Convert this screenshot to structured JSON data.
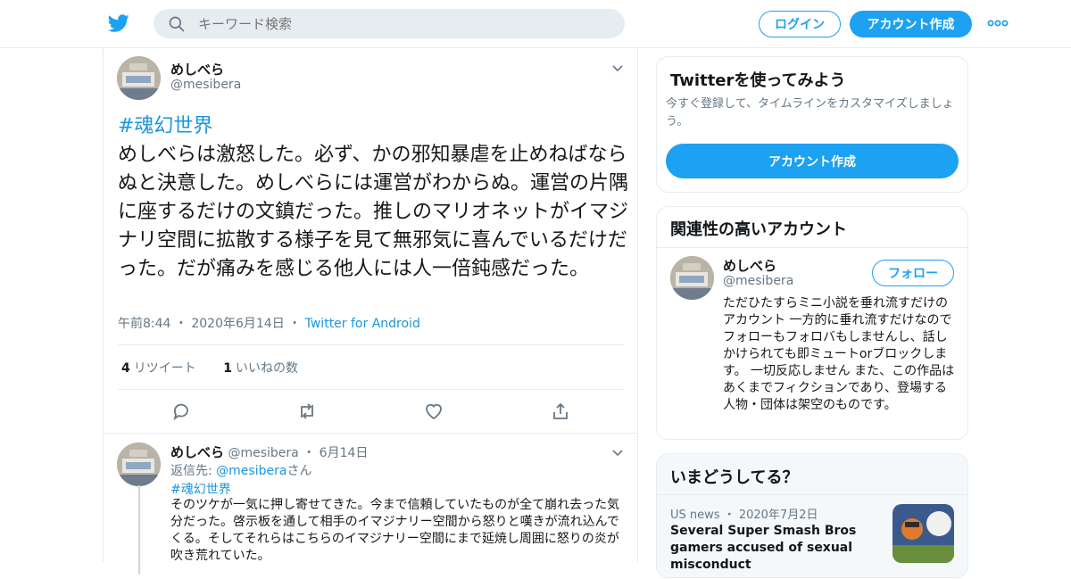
{
  "header": {
    "search_placeholder": "キーワード検索",
    "login_label": "ログイン",
    "signup_label": "アカウント作成"
  },
  "tweet": {
    "author_name": "めしべら",
    "author_handle": "@mesibera",
    "hashtag": "#魂幻世界",
    "body": "めしべらは激怒した。必ず、かの邪知暴虐を止めねばならぬと決意した。めしべらには運営がわからぬ。運営の片隅に座するだけの文鎮だった。推しのマリオネットがイマジナリ空間に拡散する様子を見て無邪気に喜んでいるだけだった。だが痛みを感じる他人には人一倍鈍感だった。",
    "time": "午前8:44",
    "date": "2020年6月14日",
    "source": "Twitter for Android",
    "retweet_count": "4",
    "retweet_label": "リツイート",
    "like_count": "1",
    "like_label": "いいねの数"
  },
  "reply": {
    "author_name": "めしべら",
    "author_handle": "@mesibera",
    "date": "6月14日",
    "reply_to_prefix": "返信先: ",
    "reply_to_handle": "@mesibera",
    "reply_to_suffix": "さん",
    "hashtag": "#魂幻世界",
    "body": "そのツケが一気に押し寄せてきた。今まで信頼していたものが全て崩れ去った気分だった。啓示板を通して相手のイマジナリー空間から怒りと嘆きが流れ込んでくる。そしてそれらはこちらのイマジナリー空間にまで延焼し周囲に怒りの炎が吹き荒れていた。"
  },
  "signup_card": {
    "title": "Twitterを使ってみよう",
    "description": "今すぐ登録して、タイムラインをカスタマイズしましょう。",
    "button_label": "アカウント作成"
  },
  "related_card": {
    "title": "関連性の高いアカウント",
    "name": "めしべら",
    "handle": "@mesibera",
    "follow_label": "フォロー",
    "bio": "ただひたすらミニ小説を垂れ流すだけのアカウント 一方的に垂れ流すだけなのでフォローもフォロバもしませんし、話しかけられても即ミュートorブロックします。 一切反応しません また、この作品はあくまでフィクションであり、登場する人物・団体は架空のものです。"
  },
  "trends_card": {
    "title": "いまどうしてる？",
    "category": "US news",
    "date": "2020年7月2日",
    "headline": "Several Super Smash Bros gamers accused of sexual misconduct"
  },
  "icons": [
    "twitter-bird-icon",
    "search-icon",
    "more-icon",
    "chevron-down-icon",
    "reply-icon",
    "retweet-icon",
    "like-icon",
    "share-icon"
  ],
  "colors": {
    "brand": "#1da1f2",
    "link": "#1b95e0",
    "muted": "#657786",
    "border": "#e6ecf0"
  }
}
